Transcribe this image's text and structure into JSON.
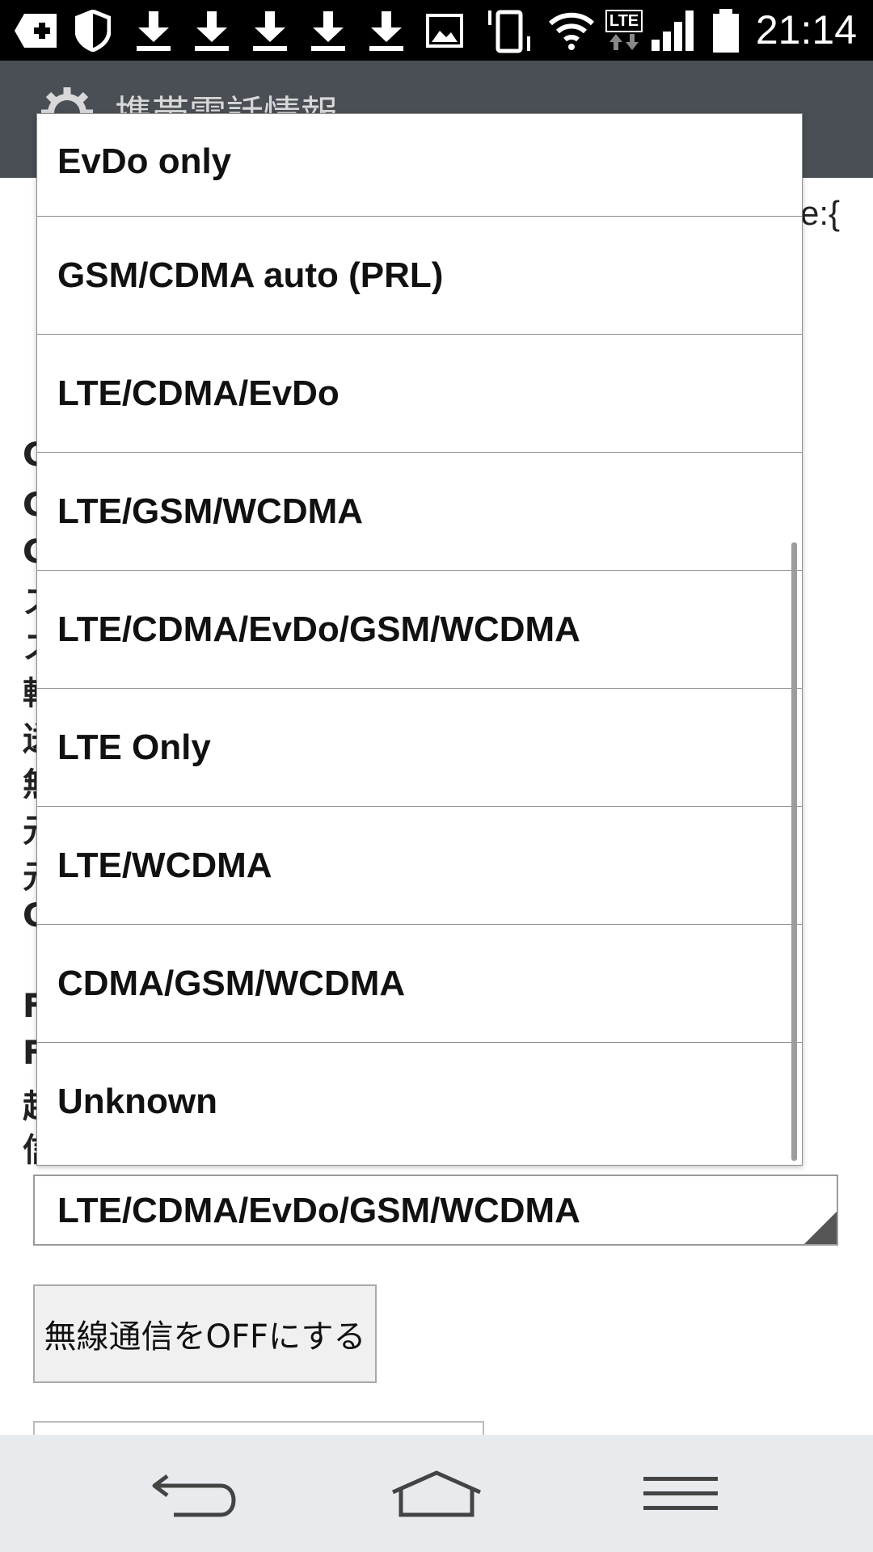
{
  "status_bar": {
    "time": "21:14",
    "network_label": "LTE",
    "icons": [
      "plus-icon",
      "shield-icon",
      "download-icon",
      "download-icon",
      "download-icon",
      "download-icon",
      "download-icon",
      "image-icon",
      "vibrate-icon",
      "wifi-icon",
      "lte-icon",
      "signal-icon",
      "battery-icon"
    ]
  },
  "action_bar": {
    "title": "携帯電話情報"
  },
  "background": {
    "right_fragment": "e:{",
    "left_fragments": [
      "C",
      "C",
      "C",
      "ス",
      "ス",
      "輯",
      "送",
      "無",
      "元",
      "元",
      "C",
      "F",
      "F",
      "起",
      "信"
    ],
    "spinner_value": "LTE/CDMA/EvDo/GSM/WCDMA",
    "radio_button_label": "無線通信をOFFにする"
  },
  "dropdown": {
    "items": [
      {
        "label": "EvDo only"
      },
      {
        "label": "GSM/CDMA auto (PRL)"
      },
      {
        "label": "LTE/CDMA/EvDo"
      },
      {
        "label": "LTE/GSM/WCDMA"
      },
      {
        "label": "LTE/CDMA/EvDo/GSM/WCDMA"
      },
      {
        "label": "LTE Only"
      },
      {
        "label": "LTE/WCDMA"
      },
      {
        "label": "CDMA/GSM/WCDMA"
      },
      {
        "label": "Unknown"
      }
    ]
  },
  "nav_bar": {
    "buttons": [
      "back-icon",
      "home-icon",
      "menu-icon"
    ]
  },
  "colors": {
    "status_bar": "#000000",
    "action_bar": "#4a4f55",
    "nav_bar": "#e8ebee",
    "divider": "#8a8a8a"
  }
}
